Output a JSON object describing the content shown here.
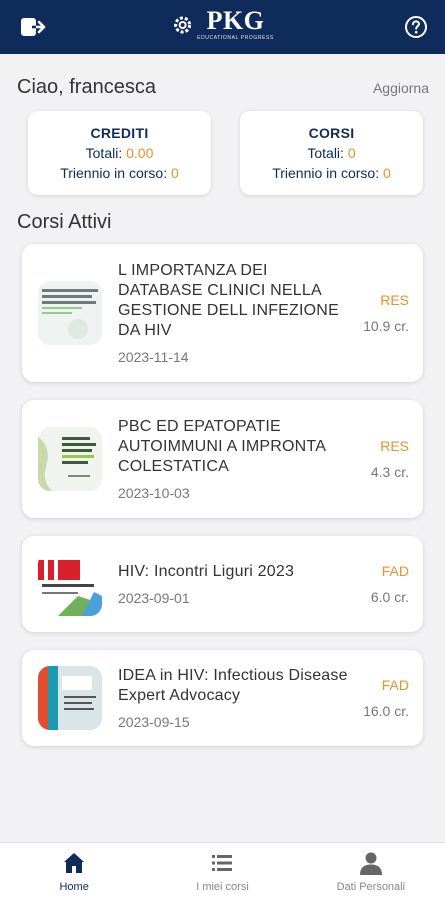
{
  "header": {
    "logo_text": "PKG",
    "logo_subtext": "EDUCATIONAL PROGRESS",
    "colors": {
      "bar": "#0f2b5b",
      "icons": "#ffffff"
    },
    "left_icon": "logout-icon",
    "right_icon": "help-icon"
  },
  "greeting": {
    "text": "Ciao, francesca",
    "refresh_label": "Aggiorna"
  },
  "stats": [
    {
      "title": "CREDITI",
      "total_label": "Totali:",
      "total_value": "0.00",
      "triennio_label": "Triennio in corso:",
      "triennio_value": "0"
    },
    {
      "title": "CORSI",
      "total_label": "Totali:",
      "total_value": "0",
      "triennio_label": "Triennio in corso:",
      "triennio_value": "0"
    }
  ],
  "section_title": "Corsi Attivi",
  "courses": [
    {
      "title": "L IMPORTANZA DEI DATABASE CLINICI NELLA GESTIONE DELL INFEZIONE DA HIV",
      "date": "2023-11-14",
      "type": "RES",
      "credits": "10.9 cr."
    },
    {
      "title": "PBC ED EPATOPATIE AUTOIMMUNI A IMPRONTA COLESTATICA",
      "date": "2023-10-03",
      "type": "RES",
      "credits": "4.3 cr."
    },
    {
      "title": "HIV: Incontri Liguri 2023",
      "date": "2023-09-01",
      "type": "FAD",
      "credits": "6.0 cr."
    },
    {
      "title": "IDEA in HIV: Infectious Disease Expert Advocacy",
      "date": "2023-09-15",
      "type": "FAD",
      "credits": "16.0 cr."
    }
  ],
  "nav": [
    {
      "label": "Home",
      "icon": "home-icon",
      "active": true
    },
    {
      "label": "I miei corsi",
      "icon": "list-icon",
      "active": false
    },
    {
      "label": "Dati Personali",
      "icon": "person-icon",
      "active": false
    }
  ],
  "accent_color": "#e8912e"
}
